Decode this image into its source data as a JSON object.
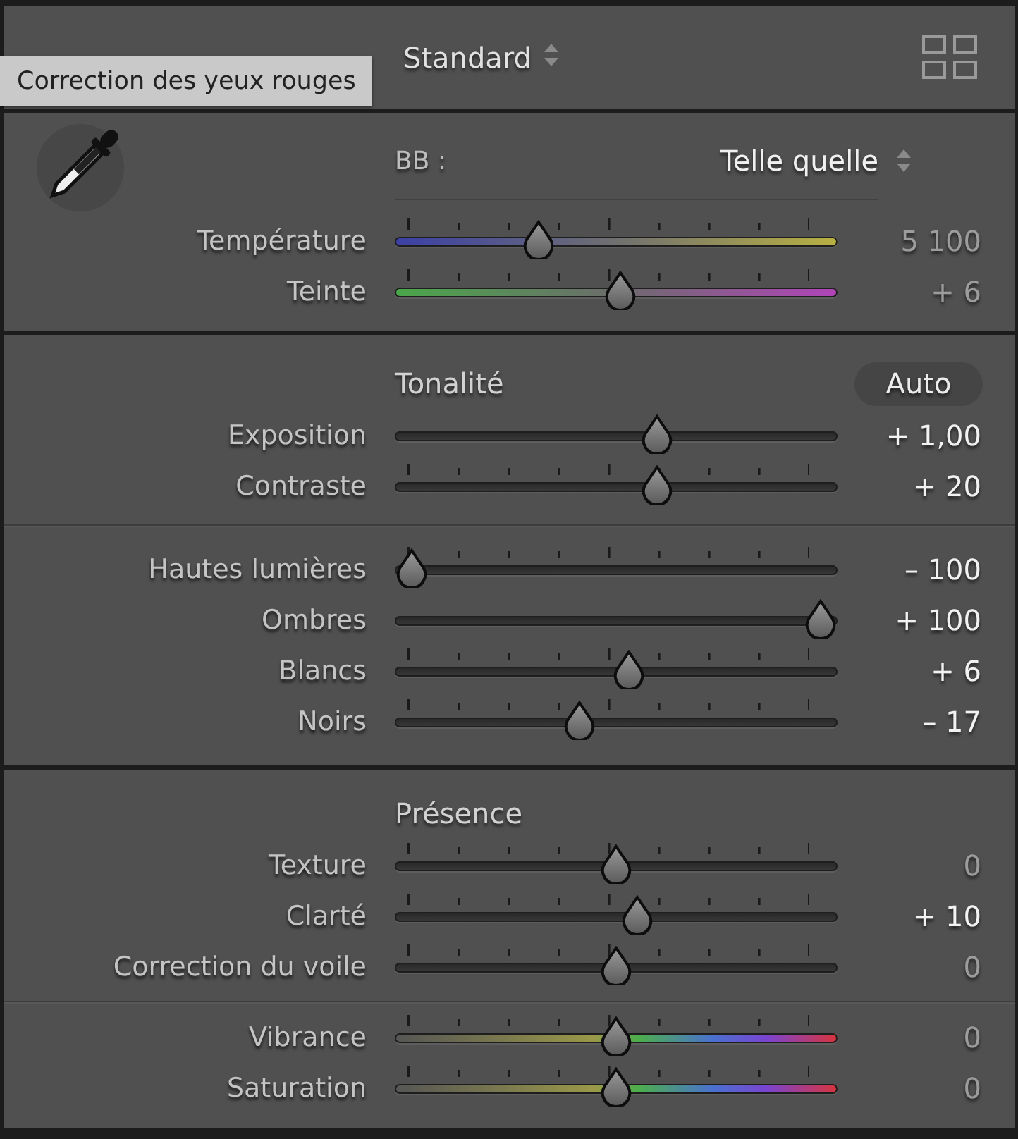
{
  "profile": {
    "value": "Standard"
  },
  "tooltip": "Correction des yeux rouges",
  "white_balance": {
    "label": "BB :",
    "value": "Telle quelle",
    "sliders": [
      {
        "label": "Température",
        "value": "5 100",
        "level": 0.31,
        "kind": "temp",
        "modified": false,
        "ticks": true
      },
      {
        "label": "Teinte",
        "value": "+ 6",
        "level": 0.51,
        "kind": "tint",
        "modified": false,
        "ticks": true
      }
    ]
  },
  "tone": {
    "title": "Tonalité",
    "auto_button": "Auto",
    "groups": [
      [
        {
          "label": "Exposition",
          "value": "+ 1,00",
          "level": 0.6,
          "kind": "plain",
          "modified": true,
          "ticks": false
        },
        {
          "label": "Contraste",
          "value": "+ 20",
          "level": 0.6,
          "kind": "plain",
          "modified": true,
          "ticks": true
        }
      ],
      [
        {
          "label": "Hautes lumières",
          "value": "– 100",
          "level": 0,
          "kind": "plain",
          "modified": true,
          "ticks": true
        },
        {
          "label": "Ombres",
          "value": "+ 100",
          "level": 1,
          "kind": "plain",
          "modified": true,
          "ticks": false
        },
        {
          "label": "Blancs",
          "value": "+ 6",
          "level": 0.53,
          "kind": "plain",
          "modified": true,
          "ticks": true
        },
        {
          "label": "Noirs",
          "value": "– 17",
          "level": 0.41,
          "kind": "plain",
          "modified": true,
          "ticks": true
        }
      ]
    ]
  },
  "presence": {
    "title": "Présence",
    "groups": [
      [
        {
          "label": "Texture",
          "value": "0",
          "level": 0.5,
          "kind": "plain",
          "modified": false,
          "ticks": true
        },
        {
          "label": "Clarté",
          "value": "+ 10",
          "level": 0.55,
          "kind": "plain",
          "modified": true,
          "ticks": true
        },
        {
          "label": "Correction du voile",
          "value": "0",
          "level": 0.5,
          "kind": "plain",
          "modified": false,
          "ticks": true
        }
      ],
      [
        {
          "label": "Vibrance",
          "value": "0",
          "level": 0.5,
          "kind": "color",
          "modified": false,
          "ticks": true
        },
        {
          "label": "Saturation",
          "value": "0",
          "level": 0.5,
          "kind": "color",
          "modified": false,
          "ticks": true
        }
      ]
    ]
  }
}
